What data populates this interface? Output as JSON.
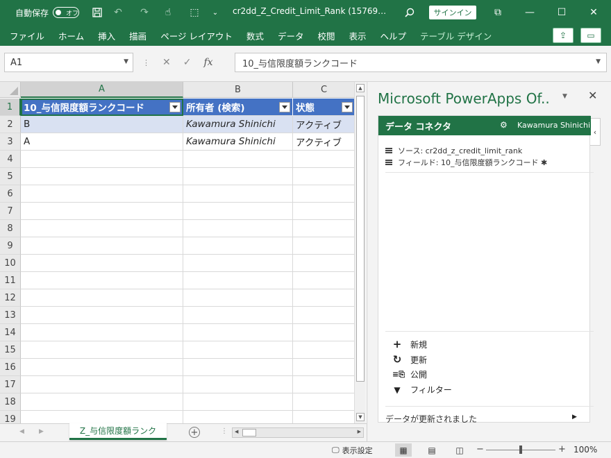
{
  "titlebar": {
    "autosave_label": "自動保存",
    "autosave_state": "オフ",
    "filename": "cr2dd_Z_Credit_Limit_Rank (15769…",
    "signin": "サインイン"
  },
  "menu": {
    "items": [
      "ファイル",
      "ホーム",
      "挿入",
      "描画",
      "ページ レイアウト",
      "数式",
      "データ",
      "校閲",
      "表示",
      "ヘルプ",
      "テーブル デザイン"
    ]
  },
  "formula": {
    "name_box": "A1",
    "fx": "fx",
    "content": "10_与信限度額ランクコード"
  },
  "grid": {
    "columns": [
      "A",
      "B",
      "C"
    ],
    "rows": [
      "1",
      "2",
      "3",
      "4",
      "5",
      "6",
      "7",
      "8",
      "9",
      "10",
      "11",
      "12",
      "13",
      "14",
      "15",
      "16",
      "17",
      "18",
      "19"
    ],
    "headers": [
      "10_与信限度額ランクコード",
      "所有者 (検索)",
      "状態"
    ],
    "data": [
      [
        "B",
        "Kawamura Shinichi",
        "アクティブ"
      ],
      [
        "A",
        "Kawamura Shinichi",
        "アクティブ"
      ]
    ]
  },
  "sheet_tabs": {
    "active": "Z_与信限度額ランク"
  },
  "pane": {
    "title": "Microsoft PowerApps Of..",
    "connector_title": "データ コネクタ",
    "user": "Kawamura Shinichi",
    "source": "ソース: cr2dd_z_credit_limit_rank",
    "field": "フィールド: 10_与信限度額ランクコード ✱",
    "actions": [
      "新規",
      "更新",
      "公開",
      "フィルター"
    ],
    "status": "データが更新されました"
  },
  "statusbar": {
    "display_settings": "表示設定",
    "zoom": "100%"
  },
  "colors": {
    "excel_green": "#217346",
    "table_header": "#4472c4",
    "table_band": "#d9e1f2"
  }
}
